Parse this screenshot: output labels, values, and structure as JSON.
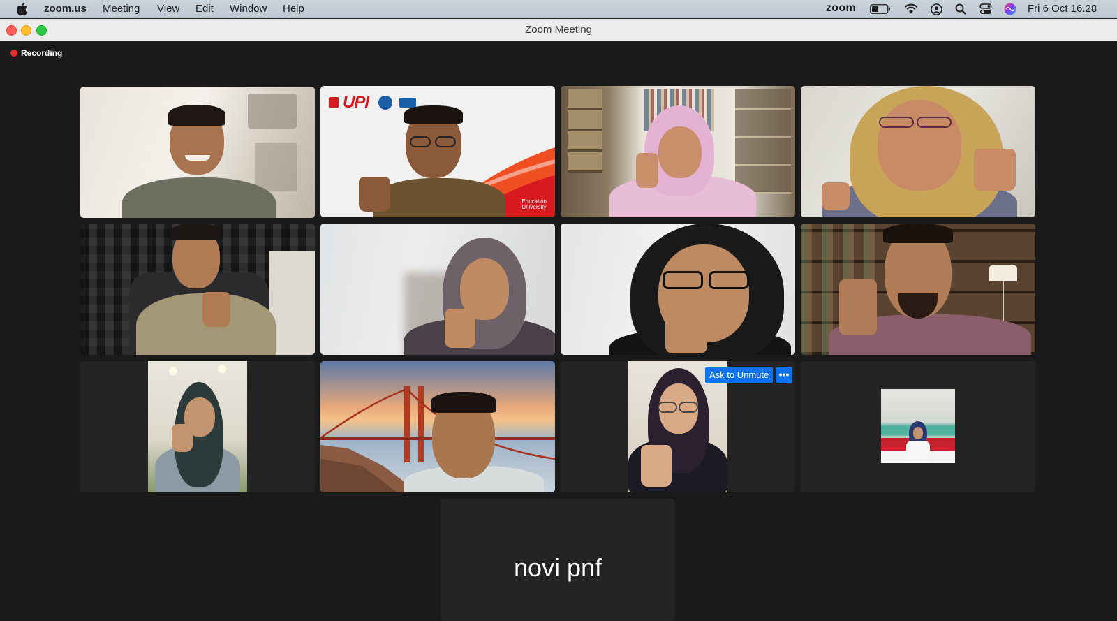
{
  "menubar": {
    "app_name": "zoom.us",
    "items": [
      "Meeting",
      "View",
      "Edit",
      "Window",
      "Help"
    ],
    "status_logo": "zoom",
    "clock": "Fri 6 Oct  16.28",
    "icons": [
      "apple-icon",
      "battery-icon",
      "wifi-icon",
      "user-icon",
      "search-icon",
      "control-center-icon",
      "siri-icon"
    ]
  },
  "window": {
    "title": "Zoom Meeting"
  },
  "meeting": {
    "recording_label": "Recording",
    "ask_to_unmute_label": "Ask to Unmute",
    "more_label": "•••",
    "tile_logo_text": "UPI",
    "tile_edu_text_1": "Education",
    "tile_edu_text_2": "University",
    "name_only_participant": "novi pnf",
    "active_speaker_color": "#34d058",
    "accent_color": "#0e72ed",
    "recording_color": "#e8312f"
  }
}
